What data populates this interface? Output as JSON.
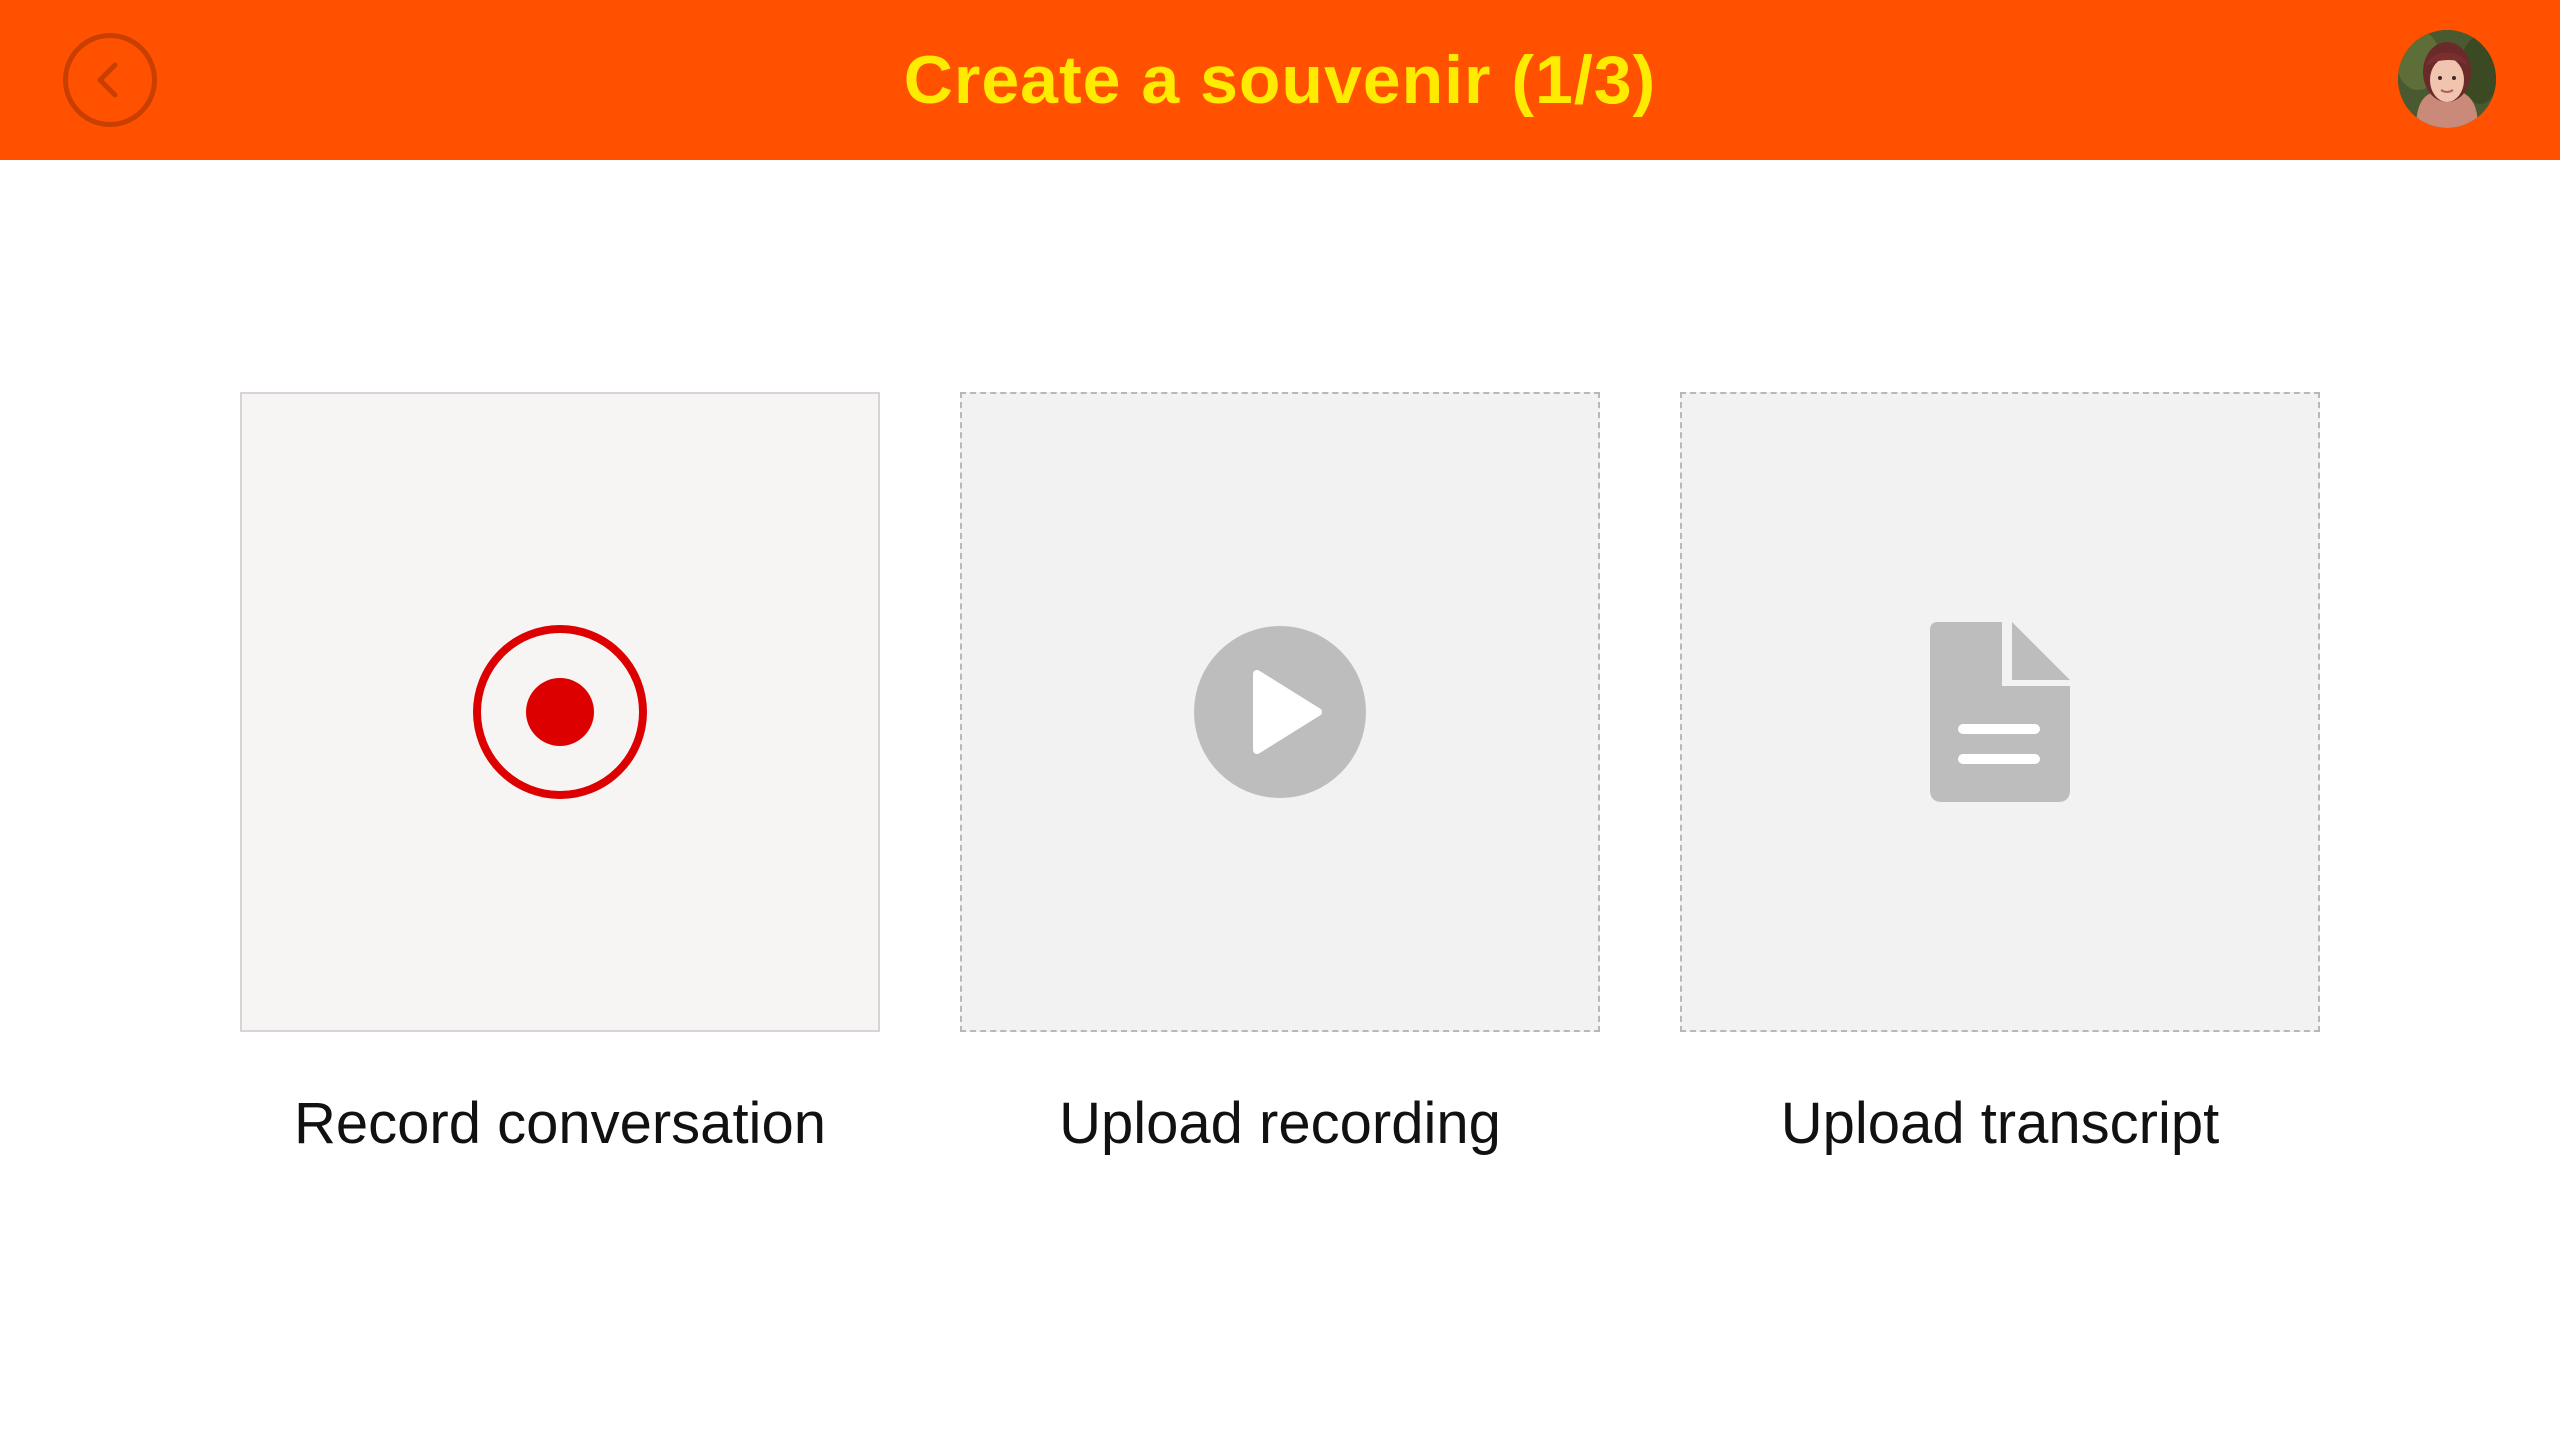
{
  "header": {
    "title": "Create a souvenir (1/3)",
    "background_color": "#ff5100",
    "title_color": "#ffeb00",
    "back_icon": "chevron-left-icon",
    "avatar_icon": "user-avatar"
  },
  "options": [
    {
      "label": "Record conversation",
      "icon": "record-icon",
      "icon_color": "#dd0000",
      "state": "active"
    },
    {
      "label": "Upload recording",
      "icon": "play-icon",
      "icon_color": "#bdbdbd",
      "state": "inactive"
    },
    {
      "label": "Upload transcript",
      "icon": "document-icon",
      "icon_color": "#bdbdbd",
      "state": "inactive"
    }
  ]
}
